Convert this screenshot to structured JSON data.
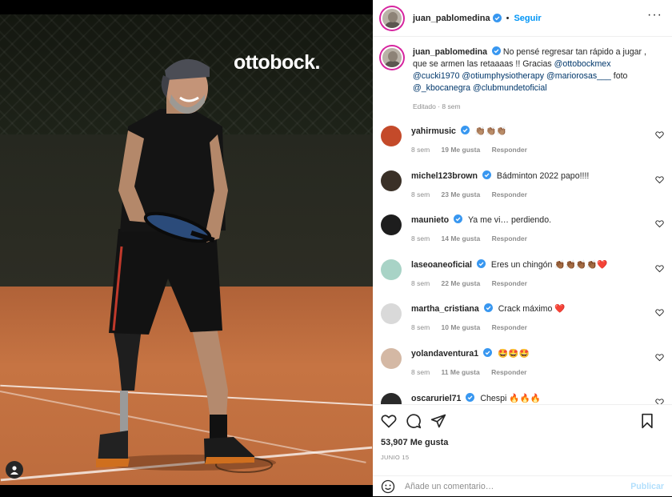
{
  "post": {
    "brand_overlay": "ottobock."
  },
  "header": {
    "username": "juan_pablomedina",
    "separator": "•",
    "follow_label": "Seguir",
    "more_label": "···"
  },
  "caption": {
    "username": "juan_pablomedina",
    "text": "No pensé regresar tan rápido a jugar , que se armen las retaaaas !! Gracias",
    "mentions": [
      "@ottobockmex",
      "@cucki1970",
      "@otiumphysiotherapy",
      "@mariorosas___",
      "@_kbocanegra",
      "@clubmundetoficial"
    ],
    "foto_word": "foto",
    "edited": "Editado · 8 sem"
  },
  "comments": [
    {
      "user": "yahirmusic",
      "text": "👏🏽👏🏽👏🏽",
      "age": "8 sem",
      "likes": "19 Me gusta",
      "reply": "Responder",
      "avatar_color": "#c44a2a"
    },
    {
      "user": "michel123brown",
      "text": "Bádminton 2022 papo!!!!",
      "age": "8 sem",
      "likes": "23 Me gusta",
      "reply": "Responder",
      "avatar_color": "#3a3027"
    },
    {
      "user": "maunieto",
      "text": "Ya me vi… perdiendo.",
      "age": "8 sem",
      "likes": "14 Me gusta",
      "reply": "Responder",
      "avatar_color": "#1d1d1d"
    },
    {
      "user": "laseoaneoficial",
      "text": "Eres un chingón 👏🏾👏🏾👏🏾👏🏾❤️",
      "age": "8 sem",
      "likes": "22 Me gusta",
      "reply": "Responder",
      "avatar_color": "#a8d3c6"
    },
    {
      "user": "martha_cristiana",
      "text": "Crack máximo ❤️",
      "age": "8 sem",
      "likes": "10 Me gusta",
      "reply": "Responder",
      "avatar_color": "#d9d9d9"
    },
    {
      "user": "yolandaventura1",
      "text": "🤩🤩🤩",
      "age": "8 sem",
      "likes": "11 Me gusta",
      "reply": "Responder",
      "avatar_color": "#d4b8a4"
    },
    {
      "user": "oscaruriel71",
      "text": "Chespi 🔥🔥🔥",
      "age": "",
      "likes": "",
      "reply": "",
      "avatar_color": "#2a2a2a"
    }
  ],
  "engagement": {
    "likes": "53,907 Me gusta",
    "date": "JUNIO 15"
  },
  "composer": {
    "placeholder": "Añade un comentario…",
    "publish_label": "Publicar"
  },
  "colors": {
    "accent": "#0095f6",
    "verified": "#3897f0",
    "mention": "#00376b",
    "muted": "#8e8e8e"
  }
}
